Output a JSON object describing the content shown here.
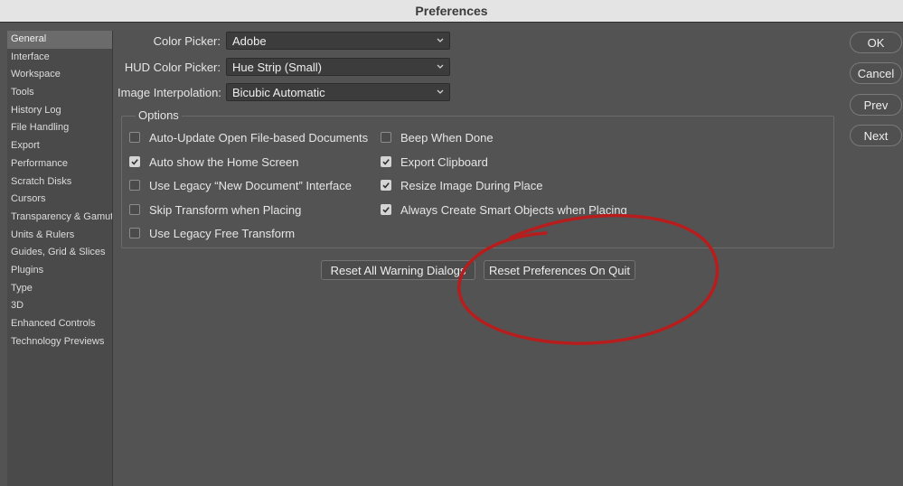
{
  "window": {
    "title": "Preferences"
  },
  "sidebar": {
    "items": [
      {
        "label": "General",
        "active": true
      },
      {
        "label": "Interface"
      },
      {
        "label": "Workspace"
      },
      {
        "label": "Tools"
      },
      {
        "label": "History Log"
      },
      {
        "label": "File Handling"
      },
      {
        "label": "Export"
      },
      {
        "label": "Performance"
      },
      {
        "label": "Scratch Disks"
      },
      {
        "label": "Cursors"
      },
      {
        "label": "Transparency & Gamut"
      },
      {
        "label": "Units & Rulers"
      },
      {
        "label": "Guides, Grid & Slices"
      },
      {
        "label": "Plugins"
      },
      {
        "label": "Type"
      },
      {
        "label": "3D"
      },
      {
        "label": "Enhanced Controls"
      },
      {
        "label": "Technology Previews"
      }
    ]
  },
  "fields": {
    "color_picker": {
      "label": "Color Picker:",
      "value": "Adobe"
    },
    "hud_color_picker": {
      "label": "HUD Color Picker:",
      "value": "Hue Strip (Small)"
    },
    "image_interpolation": {
      "label": "Image Interpolation:",
      "value": "Bicubic Automatic"
    }
  },
  "options": {
    "title": "Options",
    "left": [
      {
        "label": "Auto-Update Open File-based Documents",
        "checked": false
      },
      {
        "label": "Auto show the Home Screen",
        "checked": true
      },
      {
        "label": "Use Legacy “New Document” Interface",
        "checked": false
      },
      {
        "label": "Skip Transform when Placing",
        "checked": false
      },
      {
        "label": "Use Legacy Free Transform",
        "checked": false
      }
    ],
    "right": [
      {
        "label": "Beep When Done",
        "checked": false
      },
      {
        "label": "Export Clipboard",
        "checked": true
      },
      {
        "label": "Resize Image During Place",
        "checked": true
      },
      {
        "label": "Always Create Smart Objects when Placing",
        "checked": true
      }
    ]
  },
  "buttons": {
    "reset_warnings": "Reset All Warning Dialogs",
    "reset_prefs": "Reset Preferences On Quit",
    "ok": "OK",
    "cancel": "Cancel",
    "prev": "Prev",
    "next": "Next"
  },
  "colors": {
    "annotation": "#b81d1d",
    "background": "#535353"
  }
}
